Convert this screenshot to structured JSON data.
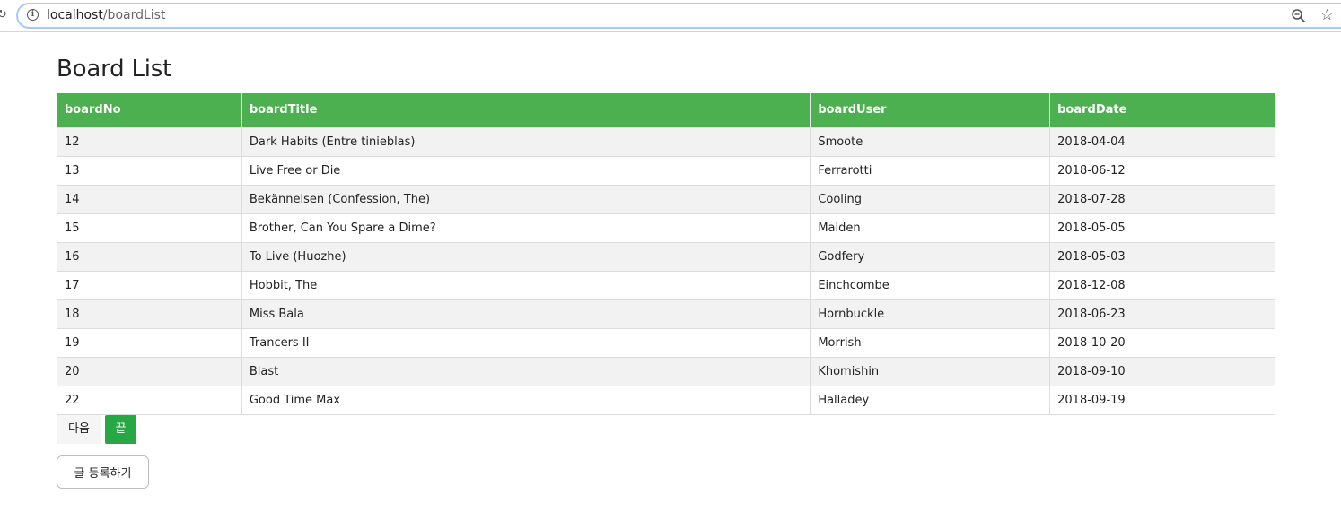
{
  "browser": {
    "url_host": "localhost",
    "url_path": "/boardList"
  },
  "page": {
    "title": "Board List"
  },
  "table": {
    "headers": [
      "boardNo",
      "boardTitle",
      "boardUser",
      "boardDate"
    ],
    "rows": [
      [
        "12",
        "Dark Habits (Entre tinieblas)",
        "Smoote",
        "2018-04-04"
      ],
      [
        "13",
        "Live Free or Die",
        "Ferrarotti",
        "2018-06-12"
      ],
      [
        "14",
        "Bekännelsen (Confession, The)",
        "Cooling",
        "2018-07-28"
      ],
      [
        "15",
        "Brother, Can You Spare a Dime?",
        "Maiden",
        "2018-05-05"
      ],
      [
        "16",
        "To Live (Huozhe)",
        "Godfery",
        "2018-05-03"
      ],
      [
        "17",
        "Hobbit, The",
        "Einchcombe",
        "2018-12-08"
      ],
      [
        "18",
        "Miss Bala",
        "Hornbuckle",
        "2018-06-23"
      ],
      [
        "19",
        "Trancers II",
        "Morrish",
        "2018-10-20"
      ],
      [
        "20",
        "Blast",
        "Khomishin",
        "2018-09-10"
      ],
      [
        "22",
        "Good Time Max",
        "Halladey",
        "2018-09-19"
      ]
    ]
  },
  "pagination": {
    "next_label": "다음",
    "last_label": "끝"
  },
  "actions": {
    "write_label": "글 등록하기"
  },
  "colors": {
    "header_bg": "#4caf50",
    "last_button_bg": "#28a745",
    "stripe_bg": "#f2f2f2"
  }
}
